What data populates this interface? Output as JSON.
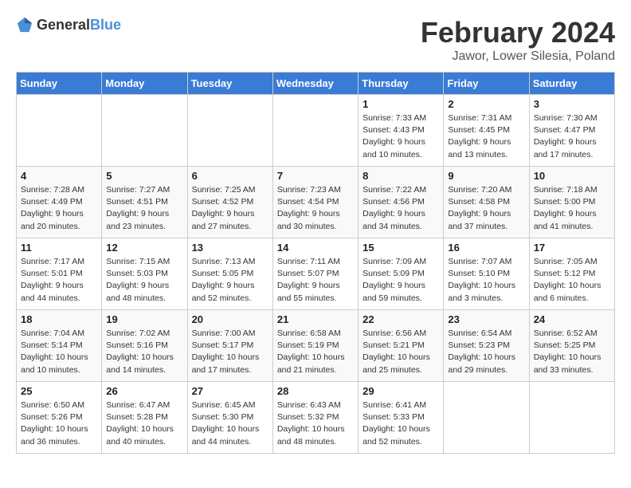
{
  "logo": {
    "general": "General",
    "blue": "Blue"
  },
  "header": {
    "month": "February 2024",
    "location": "Jawor, Lower Silesia, Poland"
  },
  "weekdays": [
    "Sunday",
    "Monday",
    "Tuesday",
    "Wednesday",
    "Thursday",
    "Friday",
    "Saturday"
  ],
  "weeks": [
    [
      {
        "day": "",
        "detail": ""
      },
      {
        "day": "",
        "detail": ""
      },
      {
        "day": "",
        "detail": ""
      },
      {
        "day": "",
        "detail": ""
      },
      {
        "day": "1",
        "detail": "Sunrise: 7:33 AM\nSunset: 4:43 PM\nDaylight: 9 hours\nand 10 minutes."
      },
      {
        "day": "2",
        "detail": "Sunrise: 7:31 AM\nSunset: 4:45 PM\nDaylight: 9 hours\nand 13 minutes."
      },
      {
        "day": "3",
        "detail": "Sunrise: 7:30 AM\nSunset: 4:47 PM\nDaylight: 9 hours\nand 17 minutes."
      }
    ],
    [
      {
        "day": "4",
        "detail": "Sunrise: 7:28 AM\nSunset: 4:49 PM\nDaylight: 9 hours\nand 20 minutes."
      },
      {
        "day": "5",
        "detail": "Sunrise: 7:27 AM\nSunset: 4:51 PM\nDaylight: 9 hours\nand 23 minutes."
      },
      {
        "day": "6",
        "detail": "Sunrise: 7:25 AM\nSunset: 4:52 PM\nDaylight: 9 hours\nand 27 minutes."
      },
      {
        "day": "7",
        "detail": "Sunrise: 7:23 AM\nSunset: 4:54 PM\nDaylight: 9 hours\nand 30 minutes."
      },
      {
        "day": "8",
        "detail": "Sunrise: 7:22 AM\nSunset: 4:56 PM\nDaylight: 9 hours\nand 34 minutes."
      },
      {
        "day": "9",
        "detail": "Sunrise: 7:20 AM\nSunset: 4:58 PM\nDaylight: 9 hours\nand 37 minutes."
      },
      {
        "day": "10",
        "detail": "Sunrise: 7:18 AM\nSunset: 5:00 PM\nDaylight: 9 hours\nand 41 minutes."
      }
    ],
    [
      {
        "day": "11",
        "detail": "Sunrise: 7:17 AM\nSunset: 5:01 PM\nDaylight: 9 hours\nand 44 minutes."
      },
      {
        "day": "12",
        "detail": "Sunrise: 7:15 AM\nSunset: 5:03 PM\nDaylight: 9 hours\nand 48 minutes."
      },
      {
        "day": "13",
        "detail": "Sunrise: 7:13 AM\nSunset: 5:05 PM\nDaylight: 9 hours\nand 52 minutes."
      },
      {
        "day": "14",
        "detail": "Sunrise: 7:11 AM\nSunset: 5:07 PM\nDaylight: 9 hours\nand 55 minutes."
      },
      {
        "day": "15",
        "detail": "Sunrise: 7:09 AM\nSunset: 5:09 PM\nDaylight: 9 hours\nand 59 minutes."
      },
      {
        "day": "16",
        "detail": "Sunrise: 7:07 AM\nSunset: 5:10 PM\nDaylight: 10 hours\nand 3 minutes."
      },
      {
        "day": "17",
        "detail": "Sunrise: 7:05 AM\nSunset: 5:12 PM\nDaylight: 10 hours\nand 6 minutes."
      }
    ],
    [
      {
        "day": "18",
        "detail": "Sunrise: 7:04 AM\nSunset: 5:14 PM\nDaylight: 10 hours\nand 10 minutes."
      },
      {
        "day": "19",
        "detail": "Sunrise: 7:02 AM\nSunset: 5:16 PM\nDaylight: 10 hours\nand 14 minutes."
      },
      {
        "day": "20",
        "detail": "Sunrise: 7:00 AM\nSunset: 5:17 PM\nDaylight: 10 hours\nand 17 minutes."
      },
      {
        "day": "21",
        "detail": "Sunrise: 6:58 AM\nSunset: 5:19 PM\nDaylight: 10 hours\nand 21 minutes."
      },
      {
        "day": "22",
        "detail": "Sunrise: 6:56 AM\nSunset: 5:21 PM\nDaylight: 10 hours\nand 25 minutes."
      },
      {
        "day": "23",
        "detail": "Sunrise: 6:54 AM\nSunset: 5:23 PM\nDaylight: 10 hours\nand 29 minutes."
      },
      {
        "day": "24",
        "detail": "Sunrise: 6:52 AM\nSunset: 5:25 PM\nDaylight: 10 hours\nand 33 minutes."
      }
    ],
    [
      {
        "day": "25",
        "detail": "Sunrise: 6:50 AM\nSunset: 5:26 PM\nDaylight: 10 hours\nand 36 minutes."
      },
      {
        "day": "26",
        "detail": "Sunrise: 6:47 AM\nSunset: 5:28 PM\nDaylight: 10 hours\nand 40 minutes."
      },
      {
        "day": "27",
        "detail": "Sunrise: 6:45 AM\nSunset: 5:30 PM\nDaylight: 10 hours\nand 44 minutes."
      },
      {
        "day": "28",
        "detail": "Sunrise: 6:43 AM\nSunset: 5:32 PM\nDaylight: 10 hours\nand 48 minutes."
      },
      {
        "day": "29",
        "detail": "Sunrise: 6:41 AM\nSunset: 5:33 PM\nDaylight: 10 hours\nand 52 minutes."
      },
      {
        "day": "",
        "detail": ""
      },
      {
        "day": "",
        "detail": ""
      }
    ]
  ]
}
